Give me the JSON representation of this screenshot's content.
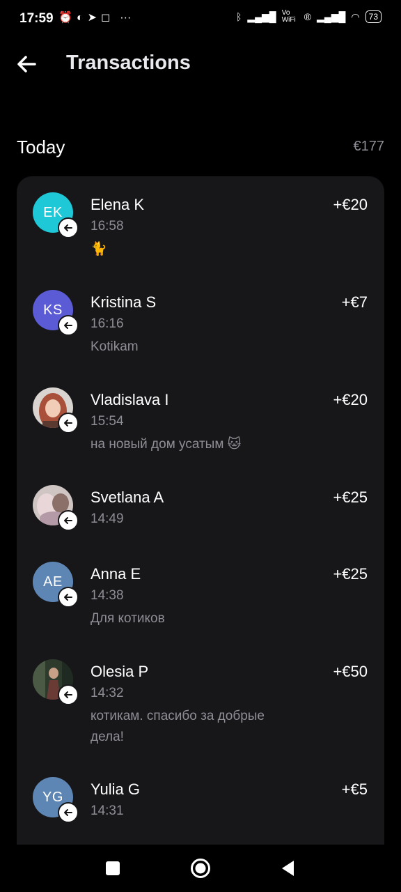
{
  "status_bar": {
    "time": "17:59",
    "left_icons": [
      "alarm-icon",
      "messenger-icon",
      "telegram-icon",
      "instagram-icon",
      "more-icon"
    ],
    "right_icons": [
      "bluetooth-icon",
      "signal-icon",
      "vowifi-icon",
      "registered-icon",
      "signal-icon",
      "wifi-icon"
    ],
    "vowifi_label": "Vo WiFi",
    "battery": "73"
  },
  "header": {
    "title": "Transactions",
    "back_icon": "arrow-left-icon"
  },
  "section": {
    "title": "Today",
    "total": "€177"
  },
  "transactions": [
    {
      "initials": "EK",
      "avatar_color": "#1fc8d6",
      "name": "Elena K",
      "time": "16:58",
      "note": "🐈",
      "amount": "+€20"
    },
    {
      "initials": "KS",
      "avatar_color": "#5b5bd6",
      "name": "Kristina S",
      "time": "16:16",
      "note": "Kotikam",
      "amount": "+€7"
    },
    {
      "initials": "",
      "avatar_color": "#8a5a4a",
      "name": "Vladislava I",
      "time": "15:54",
      "note": "на новый дом усатым 🐱",
      "amount": "+€20"
    },
    {
      "initials": "",
      "avatar_color": "#b89ca0",
      "name": "Svetlana A",
      "time": "14:49",
      "note": "",
      "amount": "+€25"
    },
    {
      "initials": "AE",
      "avatar_color": "#5e86b4",
      "name": "Anna E",
      "time": "14:38",
      "note": "Для котиков",
      "amount": "+€25"
    },
    {
      "initials": "",
      "avatar_color": "#3e4a3a",
      "name": "Olesia P",
      "time": "14:32",
      "note": "котикам. спасибо за добрые дела!",
      "amount": "+€50"
    },
    {
      "initials": "YG",
      "avatar_color": "#5e86b4",
      "name": "Yulia G",
      "time": "14:31",
      "note": "",
      "amount": "+€5"
    }
  ],
  "nav": {
    "buttons": [
      "recents-square-icon",
      "home-circle-icon",
      "back-triangle-icon"
    ]
  }
}
